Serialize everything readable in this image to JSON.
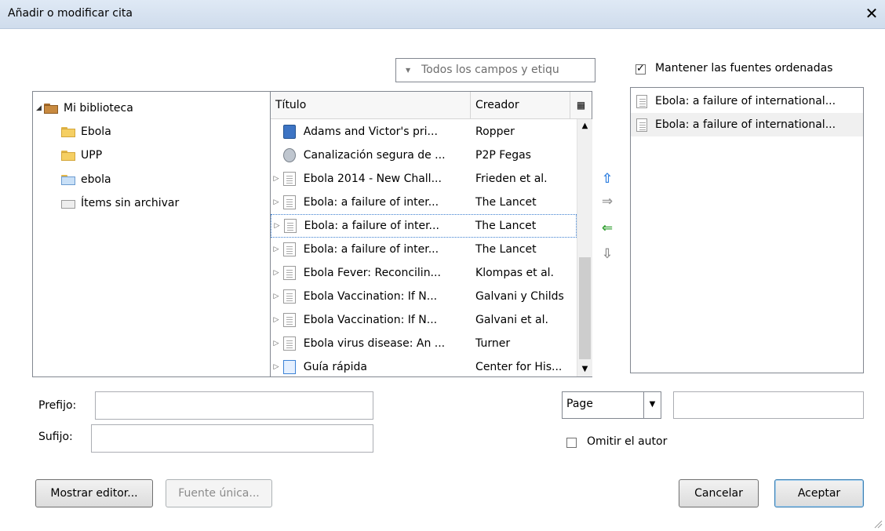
{
  "window": {
    "title": "Añadir o modificar cita",
    "close_label": "✕"
  },
  "search": {
    "placeholder": "Todos los campos y etiqu"
  },
  "keep_sorted": {
    "label": "Mantener las fuentes ordenadas",
    "checked": true
  },
  "collections": [
    {
      "label": "Mi biblioteca",
      "type": "library"
    },
    {
      "label": "Ebola",
      "type": "folder"
    },
    {
      "label": "UPP",
      "type": "folder"
    },
    {
      "label": "ebola",
      "type": "saved-search"
    },
    {
      "label": "Ítems sin archivar",
      "type": "unfiled"
    }
  ],
  "items_table": {
    "columns": [
      "Título",
      "Creador"
    ],
    "rows": [
      {
        "title": "Adams and Victor's pri...",
        "creator": "Ropper",
        "icon": "book-icon",
        "expandable": false
      },
      {
        "title": "Canalización segura de ...",
        "creator": "P2P Fegas",
        "icon": "person-icon",
        "expandable": false
      },
      {
        "title": "Ebola 2014 - New Chall...",
        "creator": "Frieden et al.",
        "icon": "document-icon",
        "expandable": true
      },
      {
        "title": "Ebola: a failure of inter...",
        "creator": "The Lancet",
        "icon": "document-icon",
        "expandable": true
      },
      {
        "title": "Ebola: a failure of inter...",
        "creator": "The Lancet",
        "icon": "document-icon",
        "expandable": true,
        "selected": true
      },
      {
        "title": "Ebola: a failure of inter...",
        "creator": "The Lancet",
        "icon": "document-icon",
        "expandable": true
      },
      {
        "title": "Ebola Fever: Reconcilin...",
        "creator": "Klompas et al.",
        "icon": "document-icon",
        "expandable": true
      },
      {
        "title": "Ebola Vaccination: If N...",
        "creator": "Galvani y Childs",
        "icon": "document-icon",
        "expandable": true
      },
      {
        "title": "Ebola Vaccination: If N...",
        "creator": "Galvani et al.",
        "icon": "document-icon",
        "expandable": true
      },
      {
        "title": "Ebola virus disease: An ...",
        "creator": "Turner",
        "icon": "document-icon",
        "expandable": true
      },
      {
        "title": "Guía rápida",
        "creator": "Center for His...",
        "icon": "blue-document-icon",
        "expandable": true
      }
    ]
  },
  "movers": {
    "up": "⇧",
    "right": "⇒",
    "left": "⇐",
    "down": "⇩"
  },
  "citations": [
    {
      "title": "Ebola: a failure of international..."
    },
    {
      "title": "Ebola: a failure of international...",
      "selected": true
    }
  ],
  "fields": {
    "prefix_label": "Prefijo:",
    "suffix_label": "Sufijo:",
    "prefix_value": "",
    "suffix_value": "",
    "locator_type": "Page",
    "locator_value": "",
    "omit_author_label": "Omitir el autor",
    "omit_author_checked": false
  },
  "buttons": {
    "show_editor": "Mostrar editor...",
    "single_source": "Fuente única...",
    "cancel": "Cancelar",
    "accept": "Aceptar"
  },
  "colors": {
    "titlebar": "#d4e1f0",
    "selection_border": "#3c7fd0",
    "mover_blue": "#2f7fe0",
    "mover_green": "#3aa33a"
  }
}
